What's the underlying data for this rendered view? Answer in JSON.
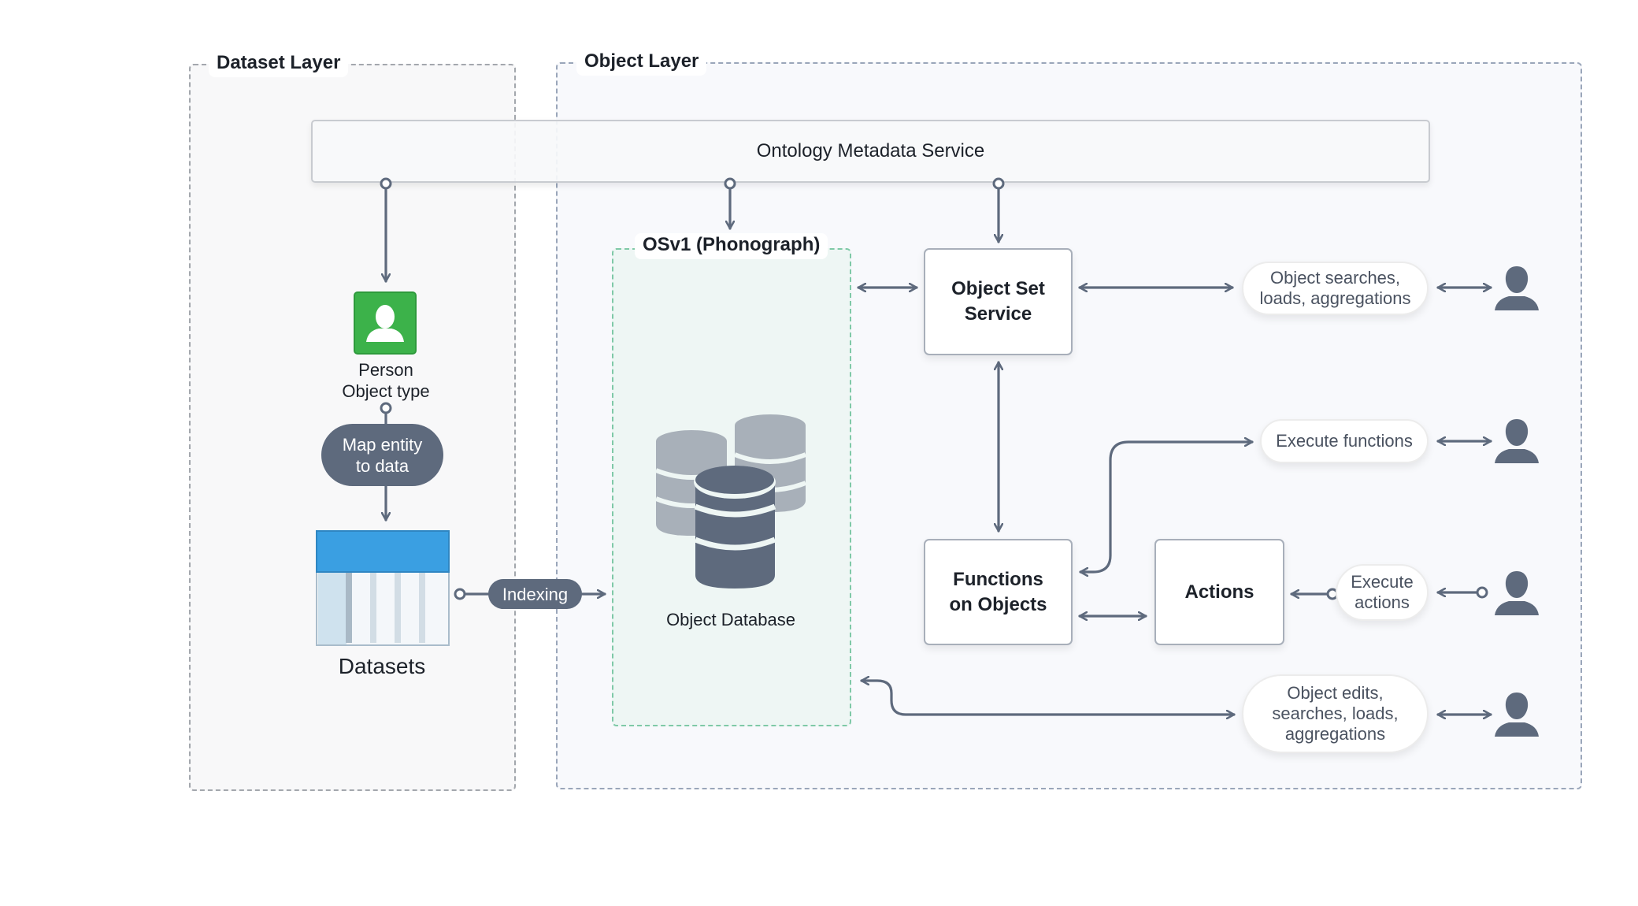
{
  "layers": {
    "dataset": {
      "label": "Dataset Layer"
    },
    "object": {
      "label": "Object Layer"
    }
  },
  "ontology_metadata_service": {
    "label": "Ontology Metadata Service"
  },
  "person_object_type": {
    "line1": "Person",
    "line2": "Object type",
    "icon": "person-icon"
  },
  "map_entity": {
    "line1": "Map entity",
    "line2": "to data"
  },
  "datasets": {
    "label": "Datasets",
    "icon": "table-icon"
  },
  "indexing": {
    "label": "Indexing"
  },
  "osv1": {
    "label": "OSv1 (Phonograph)",
    "db_label": "Object Database",
    "icon": "database-icon"
  },
  "services": {
    "object_set_service": {
      "line1": "Object Set",
      "line2": "Service"
    },
    "functions_on_objects": {
      "line1": "Functions",
      "line2": "on Objects"
    },
    "actions": {
      "label": "Actions"
    }
  },
  "user_operations": [
    {
      "line1": "Object searches,",
      "line2": "loads, aggregations",
      "line3": ""
    },
    {
      "line1": "Execute functions",
      "line2": "",
      "line3": ""
    },
    {
      "line1": "Execute",
      "line2": "actions",
      "line3": ""
    },
    {
      "line1": "Object edits,",
      "line2": "searches, loads,",
      "line3": "aggregations"
    }
  ],
  "colors": {
    "connector": "#5e6a7d",
    "person_object_type": "#3cb24a",
    "dataset_header": "#3a9fe2",
    "osv1_border": "#7fc9a7",
    "db_light": "#a8b0b9",
    "db_dark": "#5e6a7d",
    "user_icon": "#5e6a7d"
  }
}
